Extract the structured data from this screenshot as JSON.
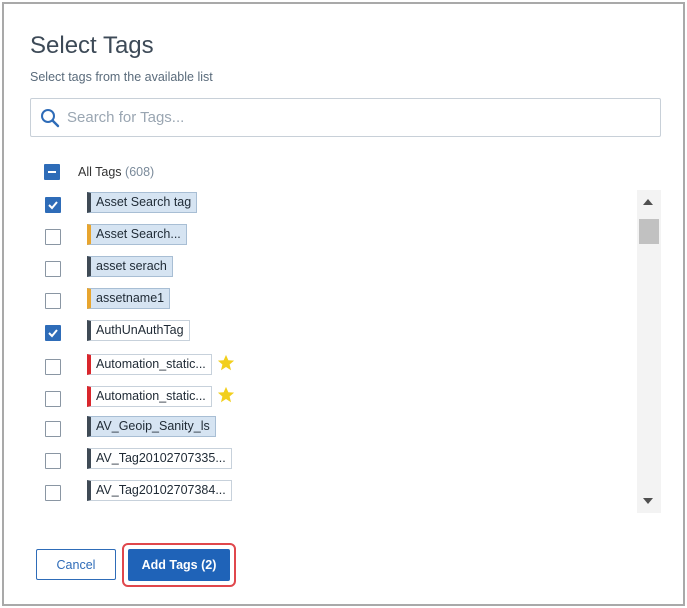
{
  "dialog": {
    "title": "Select Tags",
    "subtitle": "Select tags from the available list"
  },
  "search": {
    "placeholder": "Search for Tags...",
    "value": "",
    "icon": "search-icon"
  },
  "all_tags": {
    "label": "All Tags",
    "count": "(608)",
    "state": "partial"
  },
  "tags": [
    {
      "label": "Asset Search tag",
      "checked": true,
      "color": "#3f4a55",
      "filled": true,
      "star": false
    },
    {
      "label": "Asset Search...",
      "checked": false,
      "color": "#e8a52e",
      "filled": true,
      "star": false
    },
    {
      "label": "asset serach",
      "checked": false,
      "color": "#3f4a55",
      "filled": true,
      "star": false
    },
    {
      "label": "assetname1",
      "checked": false,
      "color": "#e8a52e",
      "filled": true,
      "star": false
    },
    {
      "label": "AuthUnAuthTag",
      "checked": true,
      "color": "#3f4a55",
      "filled": false,
      "star": false
    },
    {
      "label": "Automation_static...",
      "checked": false,
      "color": "#d9262c",
      "filled": false,
      "star": true
    },
    {
      "label": "Automation_static...",
      "checked": false,
      "color": "#d9262c",
      "filled": false,
      "star": true
    },
    {
      "label": "AV_Geoip_Sanity_ls",
      "checked": false,
      "color": "#3f4a55",
      "filled": true,
      "star": false
    },
    {
      "label": "AV_Tag20102707335...",
      "checked": false,
      "color": "#3f4a55",
      "filled": false,
      "star": false
    },
    {
      "label": "AV_Tag20102707384...",
      "checked": false,
      "color": "#3f4a55",
      "filled": false,
      "star": false
    }
  ],
  "buttons": {
    "cancel": "Cancel",
    "add": "Add Tags (2)"
  },
  "colors": {
    "accent": "#1f63b8",
    "highlight": "#e0474c",
    "star": "#f2cf1d"
  }
}
